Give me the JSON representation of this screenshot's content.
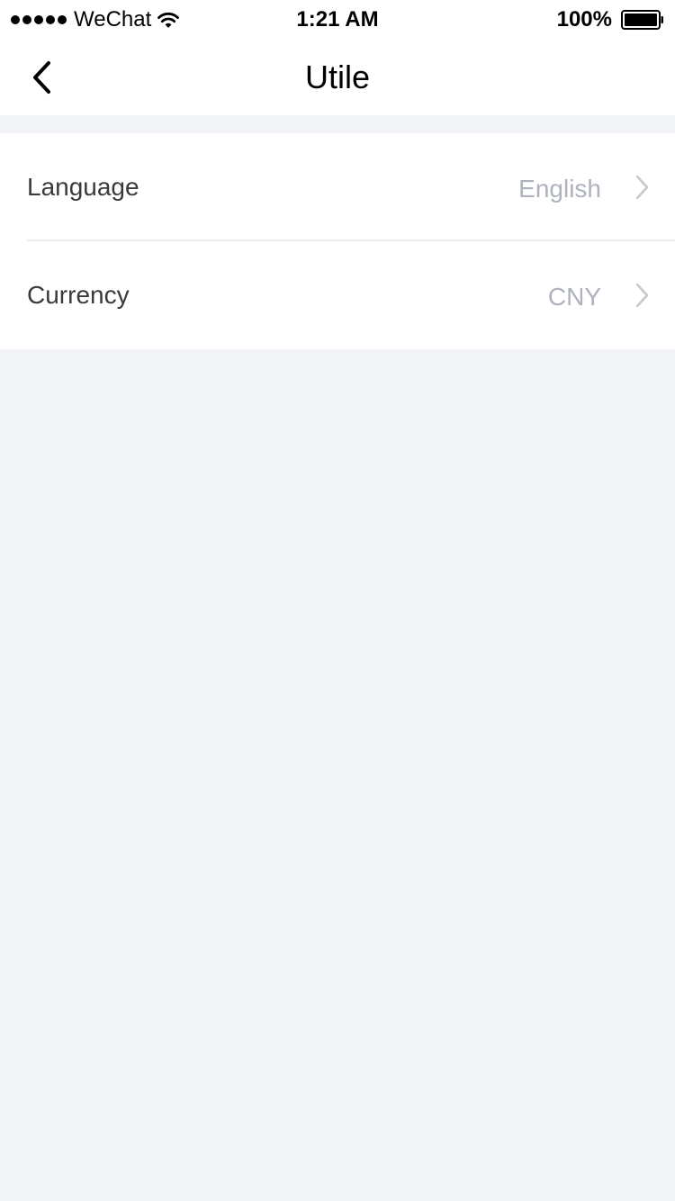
{
  "status_bar": {
    "carrier": "WeChat",
    "signal_icon": "signal-dots-icon",
    "wifi_icon": "wifi-icon",
    "time": "1:21 AM",
    "battery_percent": "100%",
    "battery_icon": "battery-icon",
    "battery_level": 1.0
  },
  "nav": {
    "back_icon": "chevron-left-icon",
    "title": "Utile"
  },
  "settings": {
    "rows": [
      {
        "label": "Language",
        "value": "English",
        "icon": "chevron-right-icon"
      },
      {
        "label": "Currency",
        "value": "CNY",
        "icon": "chevron-right-icon"
      }
    ]
  },
  "colors": {
    "background": "#f2f3f7",
    "surface": "#ffffff",
    "label_text": "#3a3a3a",
    "value_text": "#aeb2bd",
    "chevron": "#c7c7cc",
    "divider": "#ececee"
  }
}
